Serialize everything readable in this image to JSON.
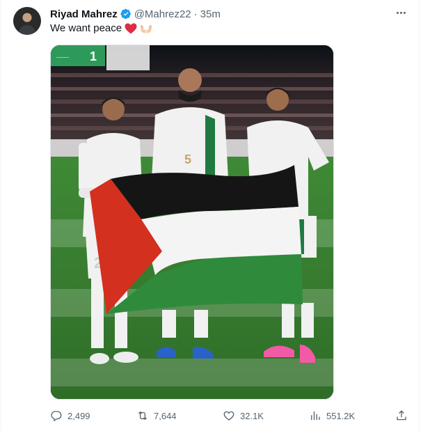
{
  "tweet": {
    "author": {
      "name": "Riyad Mahrez",
      "handle": "@Mahrez22",
      "verified": true,
      "verified_color": "#1d9bf0"
    },
    "separator": "·",
    "time": "35m",
    "text": "We want peace",
    "emojis": [
      "red-heart",
      "palms-up-together"
    ],
    "media": {
      "type": "photo",
      "scoreboard": "1"
    },
    "stats": {
      "replies": "2,499",
      "retweets": "7,644",
      "likes": "32.1K",
      "views": "551.2K"
    }
  },
  "colors": {
    "text_primary": "#0f1419",
    "text_secondary": "#536471",
    "verified": "#1d9bf0",
    "heart": "#e0245e"
  }
}
